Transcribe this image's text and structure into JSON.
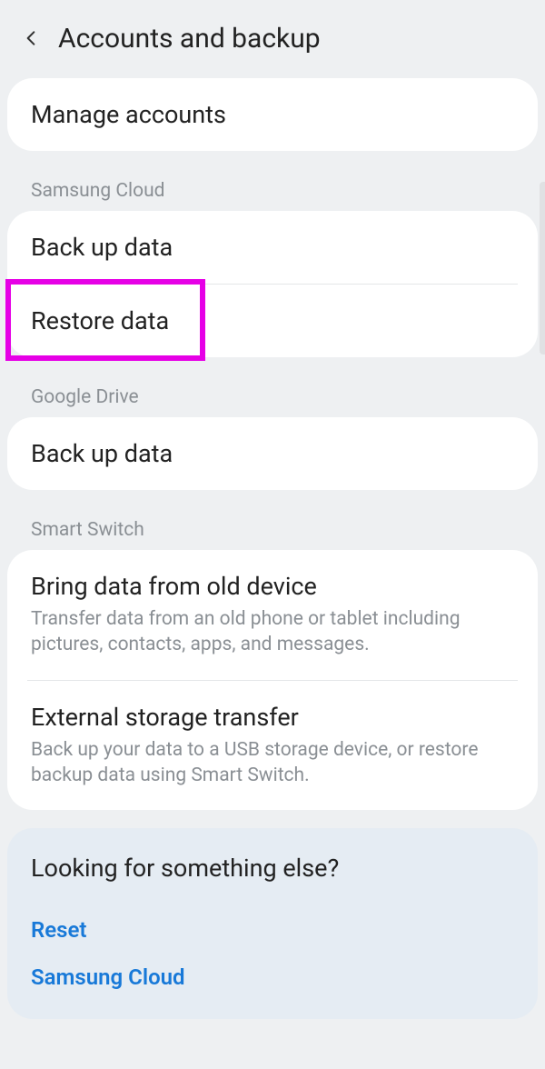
{
  "header": {
    "title": "Accounts and backup"
  },
  "manage": {
    "title": "Manage accounts"
  },
  "sections": {
    "samsung_cloud": {
      "label": "Samsung Cloud",
      "backup_title": "Back up data",
      "restore_title": "Restore data"
    },
    "google_drive": {
      "label": "Google Drive",
      "backup_title": "Back up data"
    },
    "smart_switch": {
      "label": "Smart Switch",
      "bring_title": "Bring data from old device",
      "bring_desc": "Transfer data from an old phone or tablet including pictures, contacts, apps, and messages.",
      "ext_title": "External storage transfer",
      "ext_desc": "Back up your data to a USB storage device, or restore backup data using Smart Switch."
    }
  },
  "footer": {
    "title": "Looking for something else?",
    "links": {
      "reset": "Reset",
      "samsung_cloud": "Samsung Cloud"
    }
  },
  "highlight": {
    "target": "restore-data-row"
  }
}
